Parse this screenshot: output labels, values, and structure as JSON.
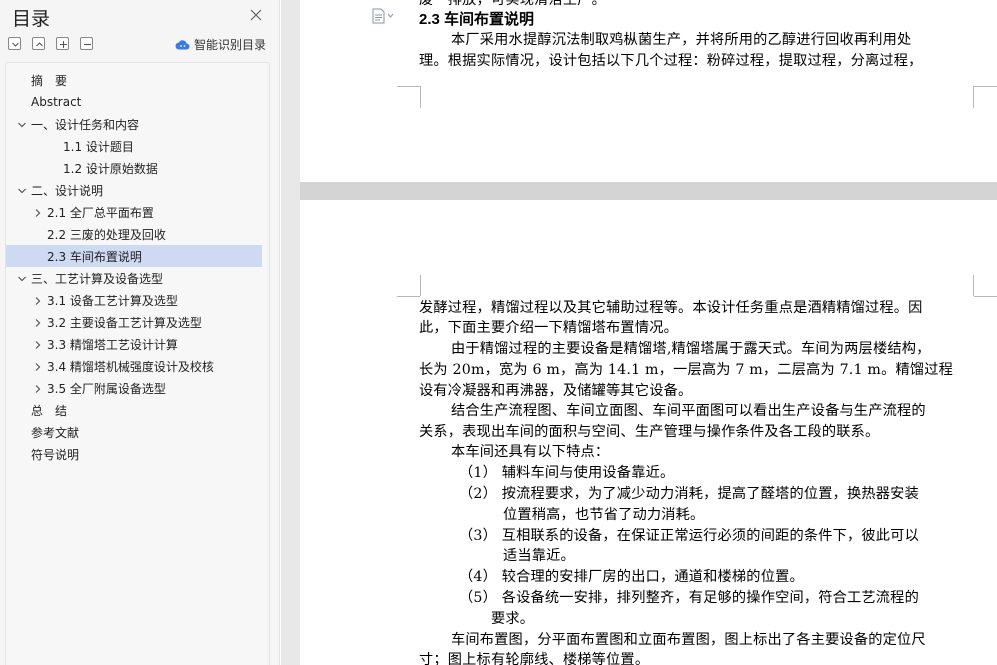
{
  "sidebar": {
    "title": "目录",
    "ai_toc_label": "智能识别目录",
    "toc": [
      {
        "label": "摘　要",
        "level": 0,
        "chevron": "none"
      },
      {
        "label": "Abstract",
        "level": 0,
        "chevron": "none"
      },
      {
        "label": "一、设计任务和内容",
        "level": 0,
        "chevron": "down"
      },
      {
        "label": "1.1  设计题目",
        "level": 2,
        "chevron": "none"
      },
      {
        "label": "1.2  设计原始数据",
        "level": 2,
        "chevron": "none"
      },
      {
        "label": "二、设计说明",
        "level": 0,
        "chevron": "down"
      },
      {
        "label": "2.1  全厂总平面布置",
        "level": 1,
        "chevron": "right"
      },
      {
        "label": "2.2  三废的处理及回收",
        "level": 1,
        "chevron": "none"
      },
      {
        "label": "2.3  车间布置说明",
        "level": 1,
        "chevron": "none",
        "selected": true
      },
      {
        "label": "三、工艺计算及设备选型",
        "level": 0,
        "chevron": "down"
      },
      {
        "label": "3.1  设备工艺计算及选型",
        "level": 1,
        "chevron": "right"
      },
      {
        "label": "3.2  主要设备工艺计算及选型",
        "level": 1,
        "chevron": "right"
      },
      {
        "label": "3.3  精馏塔工艺设计计算",
        "level": 1,
        "chevron": "right"
      },
      {
        "label": "3.4  精馏塔机械强度设计及校核",
        "level": 1,
        "chevron": "right"
      },
      {
        "label": "3.5  全厂附属设备选型",
        "level": 1,
        "chevron": "right"
      },
      {
        "label": "总　结",
        "level": 0,
        "chevron": "none"
      },
      {
        "label": "参考文献",
        "level": 0,
        "chevron": "none"
      },
      {
        "label": "符号说明",
        "level": 0,
        "chevron": "none"
      }
    ]
  },
  "document": {
    "page1": {
      "cut_line": "废一排放，可实现清洁生产。",
      "heading": "2.3  车间布置说明",
      "lines": [
        "本厂采用水提醇沉法制取鸡枞菌生产，并将所用的乙醇进行回收再利用处",
        "理。根据实际情况，设计包括以下几个过程：粉碎过程，提取过程，分离过程，"
      ]
    },
    "page2": {
      "lines": [
        "发酵过程，精馏过程以及其它辅助过程等。本设计任务重点是酒精精馏过程。因",
        "此，下面主要介绍一下精馏塔布置情况。",
        "由于精馏过程的主要设备是精馏塔,精馏塔属于露天式。车间为两层楼结构，",
        "长为 20m，宽为 6 m，高为 14.1 m，一层高为 7 m，二层高为 7.1 m。精馏过程",
        "设有冷凝器和再沸器，及储罐等其它设备。",
        "结合生产流程图、车间立面图、车间平面图可以看出生产设备与生产流程的",
        "关系，表现出车间的面积与空间、生产管理与操作条件及各工段的联系。",
        "本车间还具有以下特点：",
        "（1）  辅料车间与使用设备靠近。",
        "（2）  按流程要求，为了减少动力消耗，提高了醛塔的位置，换热器安装",
        "位置稍高，也节省了动力消耗。",
        "（3）  互相联系的设备，在保证正常运行必须的间距的条件下，彼此可以",
        "适当靠近。",
        "（4）  较合理的安排厂房的出口，通道和楼梯的位置。",
        "（5）  各设备统一安排，排列整齐，有足够的操作空间，符合工艺流程的",
        "要求。",
        "车间布置图，分平面布置图和立面布置图，图上标出了各主要设备的定位尺",
        "寸；图上标有轮廓线、楼梯等位置。"
      ]
    }
  },
  "icons": [
    "close-icon",
    "collapse-all-icon",
    "expand-all-icon",
    "add-heading-icon",
    "remove-heading-icon",
    "ai-cloud-icon",
    "document-nav-icon"
  ],
  "colors": {
    "selected_bg": "#cddaf2",
    "sidebar_bg": "#f5f5f5",
    "ai_icon": "#3a7ae8"
  }
}
